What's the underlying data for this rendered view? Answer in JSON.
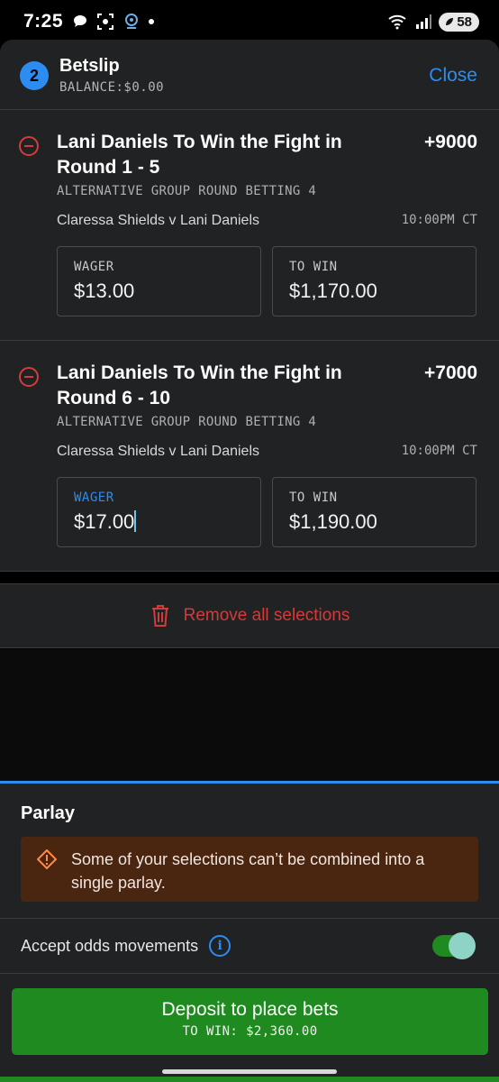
{
  "status": {
    "time": "7:25",
    "battery": "58",
    "signal_label": "5"
  },
  "header": {
    "count": "2",
    "title": "Betslip",
    "balance": "BALANCE:$0.00",
    "close_label": "Close"
  },
  "bets": [
    {
      "title": "Lani Daniels To Win the Fight in Round 1 - 5",
      "odds": "+9000",
      "market": "ALTERNATIVE GROUP ROUND BETTING 4",
      "event": "Claressa Shields v Lani Daniels",
      "time": "10:00PM CT",
      "wager_label": "WAGER",
      "wager_value": "$13.00",
      "to_win_label": "TO WIN",
      "to_win_value": "$1,170.00"
    },
    {
      "title": "Lani Daniels To Win the Fight in Round 6 - 10",
      "odds": "+7000",
      "market": "ALTERNATIVE GROUP ROUND BETTING 4",
      "event": "Claressa Shields v Lani Daniels",
      "time": "10:00PM CT",
      "wager_label": "WAGER",
      "wager_value": "$17.00",
      "to_win_label": "TO WIN",
      "to_win_value": "$1,190.00"
    }
  ],
  "remove_all_label": "Remove all selections",
  "parlay": {
    "title": "Parlay",
    "warning": "Some of your selections can’t be combined into a single parlay.",
    "accept_odds_label": "Accept odds movements",
    "accept_odds_on": true
  },
  "deposit": {
    "label": "Deposit to place bets",
    "sub": "TO WIN: $2,360.00"
  },
  "colors": {
    "accent": "#2d8cf0",
    "danger": "#d43b3b",
    "success": "#1f8a1f",
    "warning_bg": "#4a2510"
  }
}
